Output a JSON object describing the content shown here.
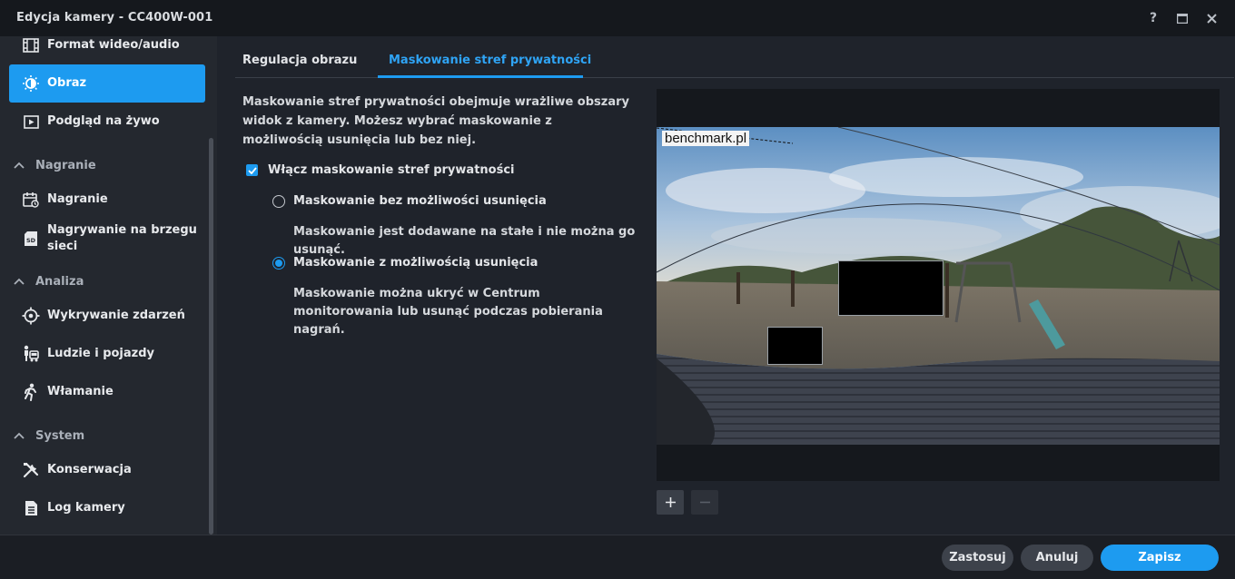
{
  "window": {
    "title": "Edycja kamery - CC400W-001",
    "help_label": "?"
  },
  "sidebar": {
    "items_top": [
      {
        "label": "Format wideo/audio",
        "icon": "film-icon"
      },
      {
        "label": "Obraz",
        "icon": "brightness-icon",
        "active": true
      },
      {
        "label": "Podgląd na żywo",
        "icon": "play-icon"
      }
    ],
    "groups": [
      {
        "title": "Nagranie",
        "items": [
          {
            "label": "Nagranie",
            "icon": "calendar-record-icon"
          },
          {
            "label": "Nagrywanie na brzegu sieci",
            "icon": "sd-card-icon"
          }
        ]
      },
      {
        "title": "Analiza",
        "items": [
          {
            "label": "Wykrywanie zdarzeń",
            "icon": "crosshair-icon"
          },
          {
            "label": "Ludzie i pojazdy",
            "icon": "person-vehicle-icon"
          },
          {
            "label": "Włamanie",
            "icon": "running-person-icon"
          }
        ]
      },
      {
        "title": "System",
        "items": [
          {
            "label": "Konserwacja",
            "icon": "tools-icon"
          },
          {
            "label": "Log kamery",
            "icon": "document-icon"
          }
        ]
      }
    ]
  },
  "tabs": [
    {
      "label": "Regulacja obrazu",
      "active": false
    },
    {
      "label": "Maskowanie stref prywatności",
      "active": true
    }
  ],
  "privacy": {
    "description": "Maskowanie stref prywatności obejmuje wrażliwe obszary widok z kamery. Możesz wybrać maskowanie z możliwością usunięcia lub bez niej.",
    "enable_label": "Włącz maskowanie stref prywatności",
    "enable_checked": true,
    "options": [
      {
        "label": "Maskowanie bez możliwości usunięcia",
        "selected": false,
        "desc": "Maskowanie jest dodawane na stałe i nie można go usunąć."
      },
      {
        "label": "Maskowanie z możliwością usunięcia",
        "selected": true,
        "desc": "Maskowanie można ukryć w Centrum monitorowania lub usunąć podczas pobierania nagrań."
      }
    ]
  },
  "preview": {
    "overlay_text": "benchmark.pl",
    "mask_count": 2
  },
  "footer": {
    "apply": "Zastosuj",
    "cancel": "Anuluj",
    "save": "Zapisz"
  },
  "colors": {
    "accent": "#1d9bf0",
    "background": "#1f232b",
    "sidebar": "#24282f"
  }
}
